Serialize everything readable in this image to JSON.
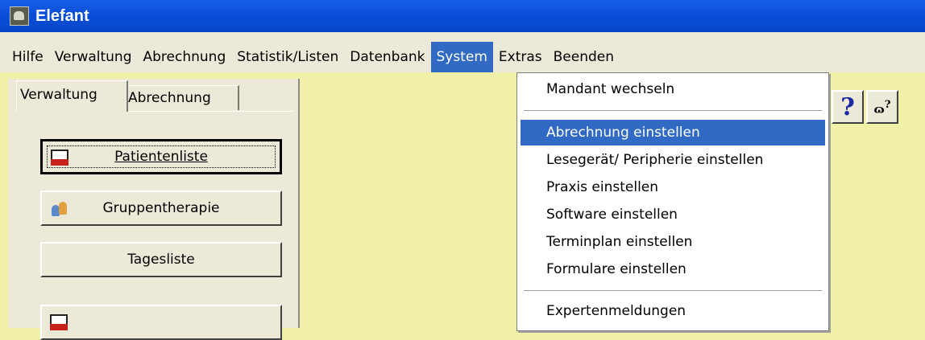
{
  "window": {
    "title": "Elefant"
  },
  "menubar": {
    "items": [
      "Hilfe",
      "Verwaltung",
      "Abrechnung",
      "Statistik/Listen",
      "Datenbank",
      "System",
      "Extras",
      "Beenden"
    ],
    "active": "System"
  },
  "tabs": [
    {
      "label": "Verwaltung",
      "selected": true
    },
    {
      "label": "Abrechnung",
      "selected": false
    }
  ],
  "buttons": {
    "patientenliste": "Patientenliste",
    "gruppentherapie": "Gruppentherapie",
    "tagesliste": "Tagesliste"
  },
  "system_menu": {
    "items": [
      "Mandant wechseln",
      "Abrechnung einstellen",
      "Lesegerät/ Peripherie einstellen",
      "Praxis einstellen",
      "Software einstellen",
      "Terminplan einstellen",
      "Formulare einstellen",
      "Expertenmeldungen"
    ],
    "highlighted": "Abrechnung einstellen"
  },
  "toolbar": {
    "help_glyph": "?",
    "contexthelp_glyph": "?"
  },
  "colors": {
    "titlebar": "#0a4ed8",
    "menu_highlight": "#316ac5",
    "background": "#f0f0a8",
    "panel": "#ece9d8"
  }
}
